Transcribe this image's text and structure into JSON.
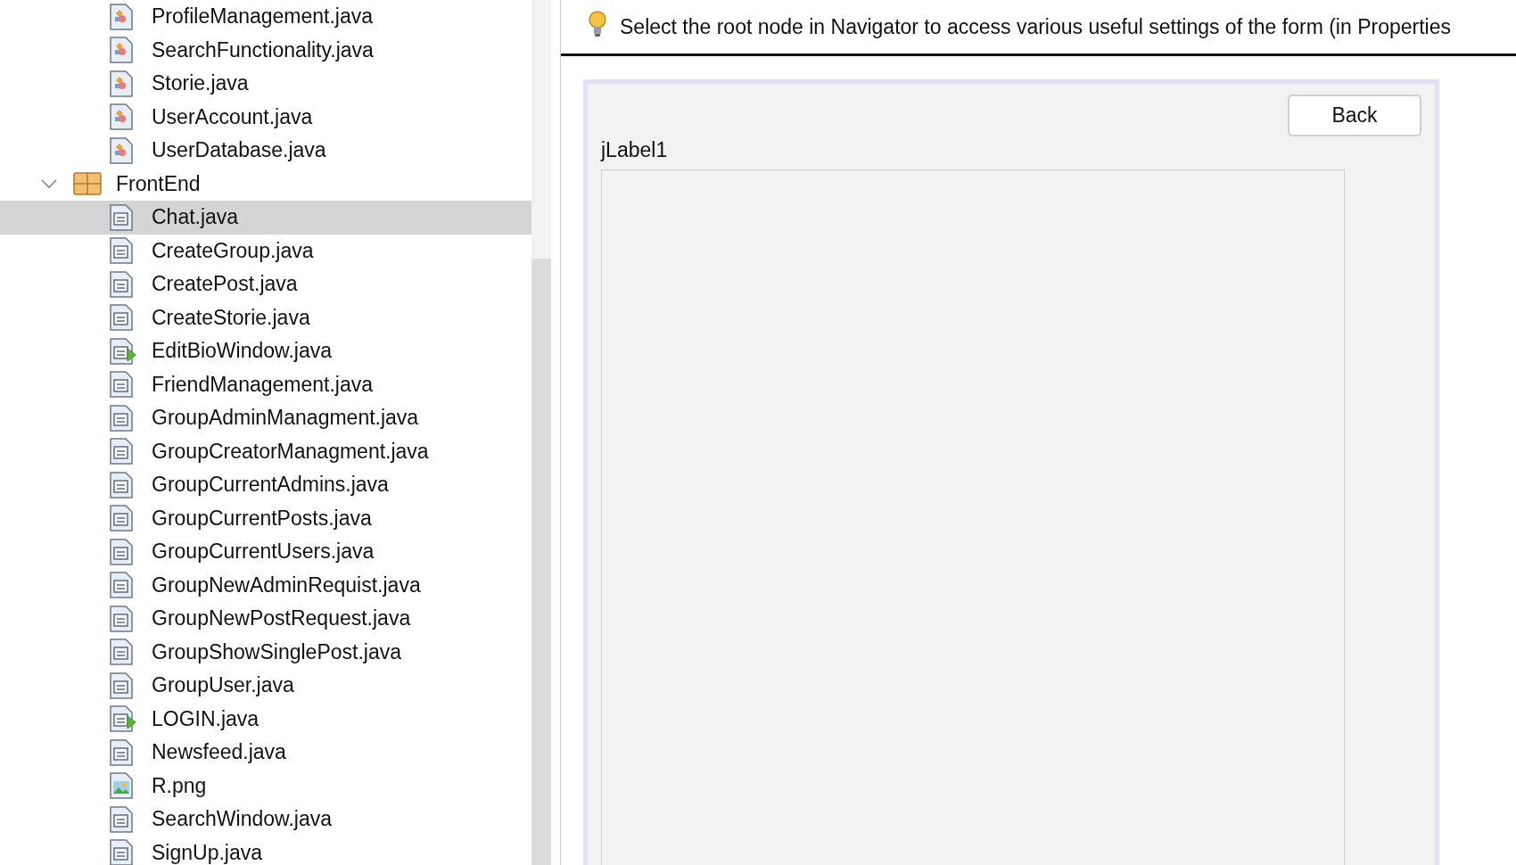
{
  "project_tree": [
    {
      "label": "ProfileManagement.java",
      "kind": "class",
      "selected": false
    },
    {
      "label": "SearchFunctionality.java",
      "kind": "class",
      "selected": false
    },
    {
      "label": "Storie.java",
      "kind": "class",
      "selected": false
    },
    {
      "label": "UserAccount.java",
      "kind": "class",
      "selected": false
    },
    {
      "label": "UserDatabase.java",
      "kind": "class",
      "selected": false
    },
    {
      "label": "FrontEnd",
      "kind": "package",
      "expanded": true,
      "selected": false,
      "children": [
        {
          "label": "Chat.java",
          "kind": "form",
          "selected": true
        },
        {
          "label": "CreateGroup.java",
          "kind": "form",
          "selected": false
        },
        {
          "label": "CreatePost.java",
          "kind": "form",
          "selected": false
        },
        {
          "label": "CreateStorie.java",
          "kind": "form",
          "selected": false
        },
        {
          "label": "EditBioWindow.java",
          "kind": "main-form",
          "selected": false
        },
        {
          "label": "FriendManagement.java",
          "kind": "form",
          "selected": false
        },
        {
          "label": "GroupAdminManagment.java",
          "kind": "form",
          "selected": false
        },
        {
          "label": "GroupCreatorManagment.java",
          "kind": "form",
          "selected": false
        },
        {
          "label": "GroupCurrentAdmins.java",
          "kind": "form",
          "selected": false
        },
        {
          "label": "GroupCurrentPosts.java",
          "kind": "form",
          "selected": false
        },
        {
          "label": "GroupCurrentUsers.java",
          "kind": "form",
          "selected": false
        },
        {
          "label": "GroupNewAdminRequist.java",
          "kind": "form",
          "selected": false
        },
        {
          "label": "GroupNewPostRequest.java",
          "kind": "form",
          "selected": false
        },
        {
          "label": "GroupShowSinglePost.java",
          "kind": "form",
          "selected": false
        },
        {
          "label": "GroupUser.java",
          "kind": "form",
          "selected": false
        },
        {
          "label": "LOGIN.java",
          "kind": "main-form",
          "selected": false
        },
        {
          "label": "Newsfeed.java",
          "kind": "form",
          "selected": false
        },
        {
          "label": "R.png",
          "kind": "image",
          "selected": false
        },
        {
          "label": "SearchWindow.java",
          "kind": "form",
          "selected": false
        },
        {
          "label": "SignUp.java",
          "kind": "form",
          "selected": false
        }
      ]
    }
  ],
  "designer": {
    "hint": "Select the root node in Navigator to access various useful settings of the form (in Properties",
    "form": {
      "back_button": "Back",
      "label": "jLabel1"
    }
  }
}
